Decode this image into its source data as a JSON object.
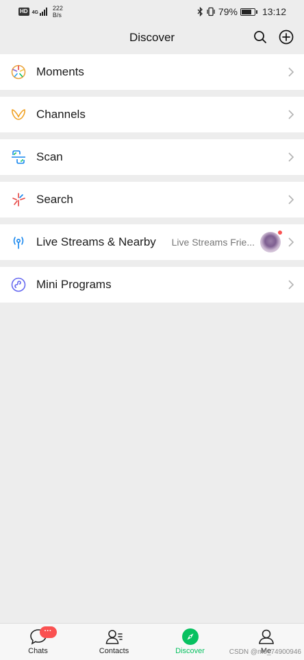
{
  "status_bar": {
    "hd": "HD",
    "network": "4G",
    "speed_value": "222",
    "speed_unit": "B/s",
    "battery": "79%",
    "battery_level": 0.79,
    "time": "13:12"
  },
  "header": {
    "title": "Discover",
    "search_icon": "search-icon",
    "add_icon": "plus-circle-icon"
  },
  "menu": [
    {
      "label": "Moments",
      "icon": "moments-icon"
    },
    {
      "label": "Channels",
      "icon": "channels-icon"
    },
    {
      "label": "Scan",
      "icon": "scan-icon"
    },
    {
      "label": "Search",
      "icon": "search-sparkle-icon"
    },
    {
      "label": "Live Streams & Nearby",
      "icon": "live-streams-icon",
      "subtitle": "Live Streams Frie...",
      "has_avatar": true,
      "has_dot": true
    },
    {
      "label": "Mini Programs",
      "icon": "mini-programs-icon"
    }
  ],
  "tabbar": {
    "tabs": [
      {
        "label": "Chats",
        "icon": "chat-bubble-icon",
        "badge": "···"
      },
      {
        "label": "Contacts",
        "icon": "contacts-icon"
      },
      {
        "label": "Discover",
        "icon": "compass-icon",
        "active": true
      },
      {
        "label": "Me",
        "icon": "person-icon"
      }
    ]
  },
  "watermark": "CSDN @m0_74900946",
  "colors": {
    "accent": "#07c160",
    "badge": "#fa5151",
    "background": "#ededed"
  }
}
